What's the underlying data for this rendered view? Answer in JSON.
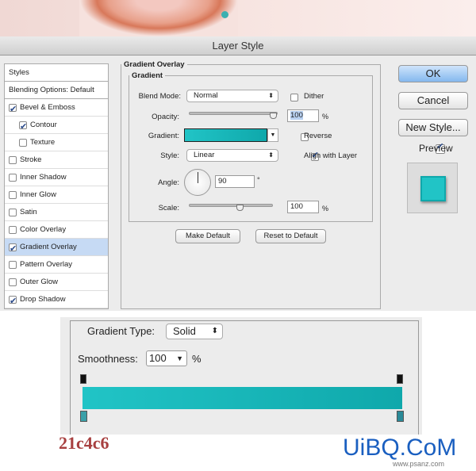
{
  "window": {
    "title": "Layer Style"
  },
  "styles_panel": {
    "items": [
      {
        "label": "Styles",
        "checkbox": null
      },
      {
        "label": "Blending Options: Default",
        "checkbox": null
      },
      {
        "label": "Bevel & Emboss",
        "checkbox": true
      },
      {
        "label": "Contour",
        "checkbox": true
      },
      {
        "label": "Texture",
        "checkbox": false
      },
      {
        "label": "Stroke",
        "checkbox": false
      },
      {
        "label": "Inner Shadow",
        "checkbox": false
      },
      {
        "label": "Inner Glow",
        "checkbox": false
      },
      {
        "label": "Satin",
        "checkbox": false
      },
      {
        "label": "Color Overlay",
        "checkbox": false
      },
      {
        "label": "Gradient Overlay",
        "checkbox": true,
        "selected": true
      },
      {
        "label": "Pattern Overlay",
        "checkbox": false
      },
      {
        "label": "Outer Glow",
        "checkbox": false
      },
      {
        "label": "Drop Shadow",
        "checkbox": true
      }
    ]
  },
  "gradient_overlay": {
    "title": "Gradient Overlay",
    "group": "Gradient",
    "blend_mode_label": "Blend Mode:",
    "blend_mode": "Normal",
    "dither_label": "Dither",
    "dither": false,
    "opacity_label": "Opacity:",
    "opacity": "100",
    "opacity_unit": "%",
    "gradient_label": "Gradient:",
    "reverse_label": "Reverse",
    "reverse": false,
    "style_label": "Style:",
    "style": "Linear",
    "align_label": "Align with Layer",
    "align": true,
    "angle_label": "Angle:",
    "angle": "90",
    "angle_unit": "°",
    "scale_label": "Scale:",
    "scale": "100",
    "scale_unit": "%",
    "make_default": "Make Default",
    "reset_default": "Reset to Default"
  },
  "buttons": {
    "ok": "OK",
    "cancel": "Cancel",
    "new_style": "New Style...",
    "preview_label": "Preview",
    "preview": true
  },
  "gradient_editor": {
    "type_label": "Gradient Type:",
    "type": "Solid",
    "smoothness_label": "Smoothness:",
    "smoothness": "100",
    "smoothness_unit": "%"
  },
  "colors": {
    "start": "#21c4c6",
    "end": "#0fa8ab"
  },
  "annotation": {
    "left_hex": "21c4c6"
  },
  "watermark": {
    "text": "UiBQ.CoM",
    "sub": "www.psanz.com"
  }
}
